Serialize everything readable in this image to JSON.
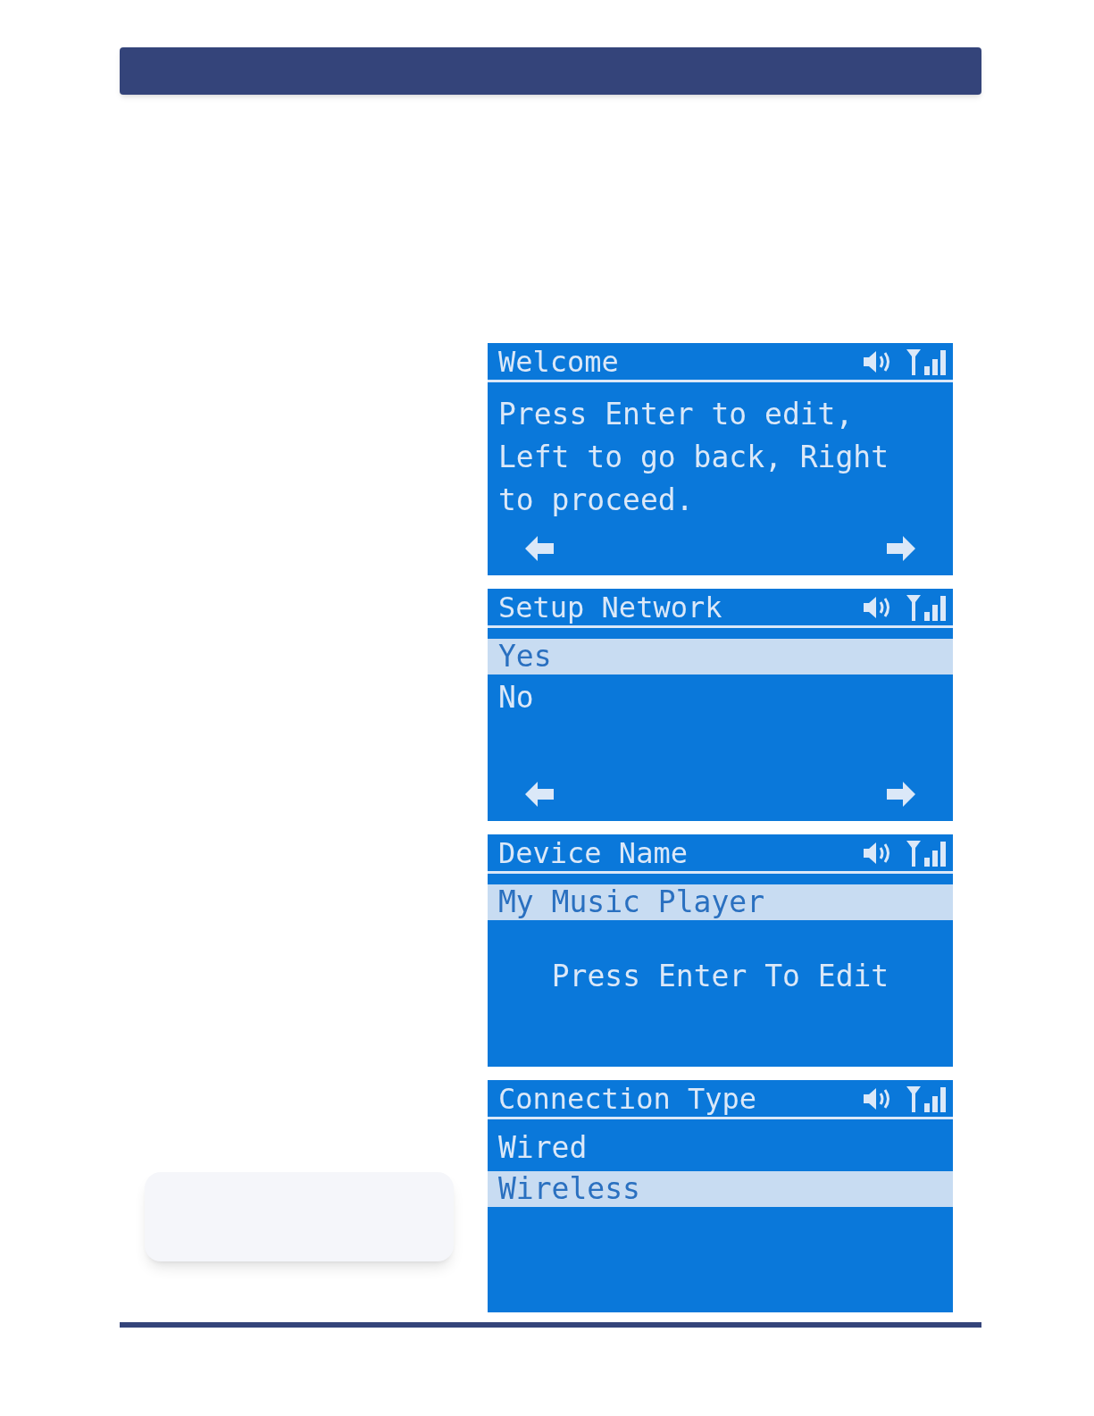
{
  "screens": [
    {
      "kind": "message",
      "title": "Welcome",
      "lines": [
        "Press Enter to edit,",
        "Left to go back, Right",
        "to proceed."
      ],
      "arrows": true
    },
    {
      "kind": "list",
      "title": "Setup Network",
      "options": [
        {
          "label": "Yes",
          "selected": true
        },
        {
          "label": "No",
          "selected": false
        }
      ],
      "arrows": true
    },
    {
      "kind": "field",
      "title": "Device Name",
      "value": "My Music Player",
      "selected": true,
      "hint": "Press Enter To Edit",
      "arrows": false
    },
    {
      "kind": "list",
      "title": "Connection Type",
      "options": [
        {
          "label": "Wired",
          "selected": false
        },
        {
          "label": "Wireless",
          "selected": true
        }
      ],
      "arrows": false
    }
  ]
}
